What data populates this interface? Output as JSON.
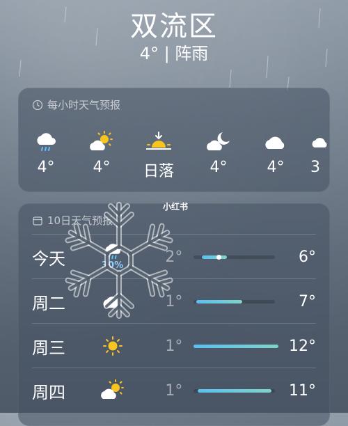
{
  "location": {
    "city": "双流区",
    "current": "4° | 阵雨"
  },
  "hourly": {
    "title": "每小时天气预报",
    "items": [
      {
        "icon": "rain-cloud-icon",
        "temp": "4°"
      },
      {
        "icon": "partly-sunny-icon",
        "temp": "4°"
      },
      {
        "icon": "sunset-icon",
        "temp": "日落"
      },
      {
        "icon": "partly-cloudy-night-icon",
        "temp": "4°"
      },
      {
        "icon": "cloud-icon",
        "temp": "4°"
      },
      {
        "icon": "cloud-icon",
        "temp": "3"
      }
    ]
  },
  "daily": {
    "title": "10日天气预报",
    "items": [
      {
        "day": "今天",
        "icon": "rain-cloud-icon",
        "pop": "30%",
        "low": "2°",
        "high": "6°"
      },
      {
        "day": "周二",
        "icon": "cloud-icon",
        "pop": "",
        "low": "1°",
        "high": "7°"
      },
      {
        "day": "周三",
        "icon": "sun-icon",
        "pop": "",
        "low": "1°",
        "high": "12°"
      },
      {
        "day": "周四",
        "icon": "partly-sunny-icon",
        "pop": "",
        "low": "1°",
        "high": "11°"
      }
    ]
  },
  "watermark": "小红书",
  "colors": {
    "bar_start": "#59c0f0",
    "bar_end": "#7fd3c8",
    "pop_text": "#8fd0ff",
    "sun": "#f7c51e"
  }
}
